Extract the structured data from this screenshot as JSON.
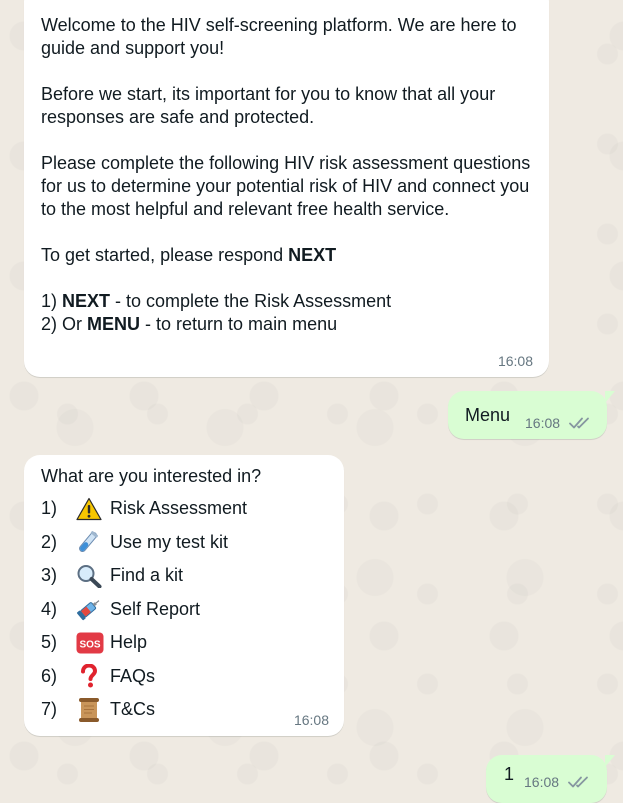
{
  "chat": {
    "welcome": {
      "line1": "Welcome to the HIV self-screening platform. We are here to guide and support you!",
      "line2": "Before we start, its important for you to know that all your responses are safe and protected.",
      "line3": "Please complete the following HIV risk assessment questions for us to determine your potential risk of HIV and connect you to the most helpful and relevant free health service.",
      "line4_prefix": "To get started, please respond ",
      "line4_bold": "NEXT",
      "option1_prefix": "1) ",
      "option1_bold": "NEXT",
      "option1_rest": " - to complete the Risk Assessment",
      "option2_prefix": "2) Or ",
      "option2_bold": "MENU",
      "option2_rest": " - to return to main menu",
      "time": "16:08"
    },
    "reply1": {
      "text": "Menu",
      "time": "16:08"
    },
    "menu": {
      "title": "What are you interested in?",
      "items": [
        {
          "num": "1)",
          "icon": "warning-icon",
          "label": "Risk Assessment"
        },
        {
          "num": "2)",
          "icon": "test-tube-icon",
          "label": "Use my test kit"
        },
        {
          "num": "3)",
          "icon": "magnifier-icon",
          "label": "Find a kit"
        },
        {
          "num": "4)",
          "icon": "syringe-icon",
          "label": "Self Report"
        },
        {
          "num": "5)",
          "icon": "sos-icon",
          "label": "Help"
        },
        {
          "num": "6)",
          "icon": "question-icon",
          "label": "FAQs"
        },
        {
          "num": "7)",
          "icon": "scroll-icon",
          "label": "T&Cs"
        }
      ],
      "time": "16:08"
    },
    "reply2": {
      "text": "1",
      "time": "16:08"
    }
  },
  "colors": {
    "background": "#efeae2",
    "incoming_bubble": "#ffffff",
    "outgoing_bubble": "#d9fdd3",
    "timestamp": "#667781",
    "read_ticks": "#8696a0"
  }
}
